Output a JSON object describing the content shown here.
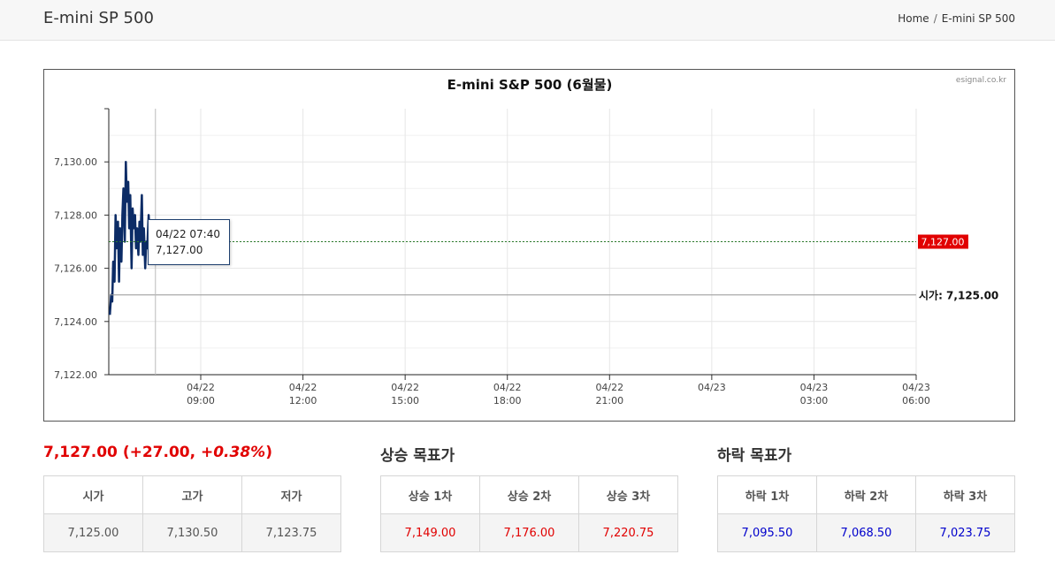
{
  "header": {
    "title": "E-mini SP 500",
    "breadcrumb": {
      "home": "Home",
      "separator": "/",
      "current": "E-mini SP 500"
    }
  },
  "chart": {
    "watermark": "esignal.co.kr",
    "tooltip": {
      "time": "04/22 07:40",
      "value": "7,127.00"
    },
    "current_label": "7,127.00",
    "open_label": "시가: 7,125.00",
    "colors": {
      "line": "#0c2c66",
      "current": "#e10000",
      "open_line": "#999999",
      "grid": "#e6e6e6"
    }
  },
  "chart_data": {
    "type": "line",
    "title": "E-mini S&P 500 (6월물)",
    "xlabel": "",
    "ylabel": "",
    "ylim": [
      7122,
      7132
    ],
    "y_ticks": [
      "7,122.00",
      "7,124.00",
      "7,126.00",
      "7,128.00",
      "7,130.00"
    ],
    "x_ticks": [
      {
        "date": "04/22",
        "time": "09:00"
      },
      {
        "date": "04/22",
        "time": "12:00"
      },
      {
        "date": "04/22",
        "time": "15:00"
      },
      {
        "date": "04/22",
        "time": "18:00"
      },
      {
        "date": "04/22",
        "time": "21:00"
      },
      {
        "date": "04/23",
        "time": ""
      },
      {
        "date": "04/23",
        "time": "03:00"
      },
      {
        "date": "04/23",
        "time": "06:00"
      }
    ],
    "x_range_hours": [
      6.3,
      30.0
    ],
    "series": [
      {
        "x_hours": [
          6.33,
          6.37,
          6.4,
          6.43,
          6.47,
          6.5,
          6.53,
          6.57,
          6.6,
          6.63,
          6.67,
          6.7,
          6.73,
          6.77,
          6.8,
          6.83,
          6.87,
          6.9,
          6.93,
          6.97,
          7.0,
          7.03,
          7.07,
          7.1,
          7.13,
          7.17,
          7.2,
          7.23,
          7.27,
          7.3,
          7.33,
          7.37,
          7.4,
          7.43,
          7.47,
          7.5,
          7.53,
          7.57,
          7.6,
          7.63,
          7.67
        ],
        "values": [
          7124.25,
          7125.0,
          7124.75,
          7126.25,
          7125.5,
          7128.0,
          7126.75,
          7127.75,
          7125.5,
          7127.5,
          7126.25,
          7128.0,
          7129.0,
          7127.0,
          7130.0,
          7128.5,
          7129.25,
          7127.5,
          7128.75,
          7126.0,
          7128.25,
          7127.5,
          7128.0,
          7126.75,
          7127.5,
          7126.5,
          7127.75,
          7127.0,
          7128.75,
          7126.5,
          7127.5,
          7126.0,
          7127.0,
          7126.75,
          7128.0,
          7127.25,
          7126.75,
          7127.5,
          7127.0,
          7127.25,
          7127.0
        ]
      }
    ],
    "current_value": 7127.0,
    "open_value": 7125.0
  },
  "summary": {
    "price": "7,127.00",
    "change": "(+27.00, ",
    "pct": "+0.38%",
    "close": ")"
  },
  "ohlc": {
    "headers": [
      "시가",
      "고가",
      "저가"
    ],
    "values": [
      "7,125.00",
      "7,130.50",
      "7,123.75"
    ]
  },
  "up_targets": {
    "title": "상승 목표가",
    "headers": [
      "상승 1차",
      "상승 2차",
      "상승 3차"
    ],
    "values": [
      "7,149.00",
      "7,176.00",
      "7,220.75"
    ]
  },
  "down_targets": {
    "title": "하락 목표가",
    "headers": [
      "하락 1차",
      "하락 2차",
      "하락 3차"
    ],
    "values": [
      "7,095.50",
      "7,068.50",
      "7,023.75"
    ]
  }
}
